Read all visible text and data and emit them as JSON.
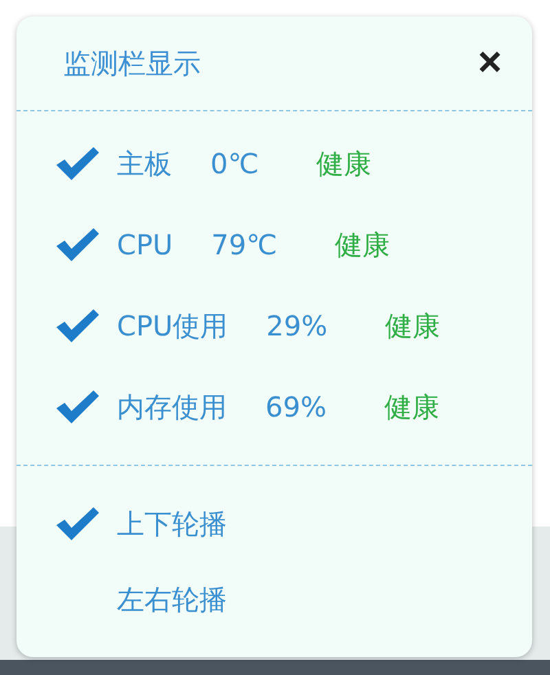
{
  "panel": {
    "title": "监测栏显示",
    "close": "×"
  },
  "metrics": [
    {
      "label": "主板",
      "value": "0℃",
      "status": "健康",
      "checked": true
    },
    {
      "label": "CPU",
      "value": "79℃",
      "status": "健康",
      "checked": true
    },
    {
      "label": "CPU使用",
      "value": "29%",
      "status": "健康",
      "checked": true
    },
    {
      "label": "内存使用",
      "value": "69%",
      "status": "健康",
      "checked": true
    }
  ],
  "scroll_modes": [
    {
      "label": "上下轮播",
      "checked": true
    },
    {
      "label": "左右轮播",
      "checked": false
    }
  ]
}
